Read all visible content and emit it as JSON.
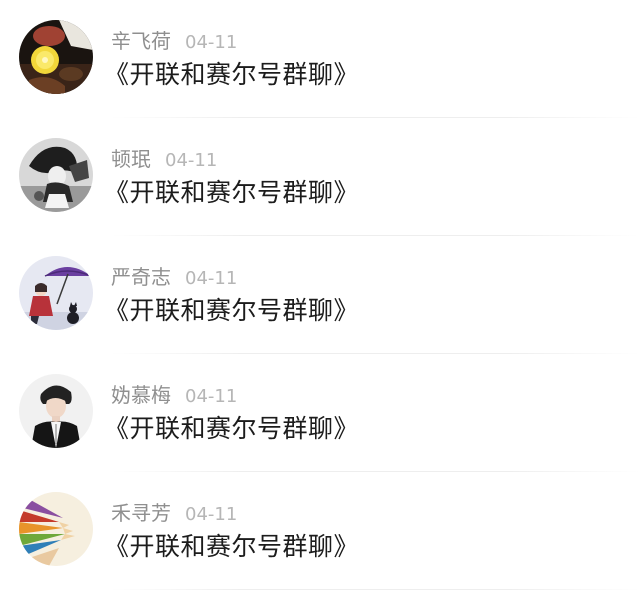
{
  "comments": [
    {
      "name": "辛飞荷",
      "time": "04-11",
      "message": "《开联和赛尔号群聊》",
      "avatar_icon": "avatar-lemon-drink-photo",
      "colors": {
        "bg": "#1a1410",
        "accent": "#f2d73a"
      }
    },
    {
      "name": "顿珉",
      "time": "04-11",
      "message": "《开联和赛尔号群聊》",
      "avatar_icon": "avatar-monochrome-girl-illustration",
      "colors": {
        "bg": "#d8d8d8",
        "accent": "#1e1e1e"
      }
    },
    {
      "name": "严奇志",
      "time": "04-11",
      "message": "《开联和赛尔号群聊》",
      "avatar_icon": "avatar-umbrella-girl-cat-illustration",
      "colors": {
        "bg": "#e6e8f2",
        "accent": "#6a3fa0"
      }
    },
    {
      "name": "妫慕梅",
      "time": "04-11",
      "message": "《开联和赛尔号群聊》",
      "avatar_icon": "avatar-boy-portrait-photo",
      "colors": {
        "bg": "#f1f1f1",
        "accent": "#222222"
      }
    },
    {
      "name": "禾寻芳",
      "time": "04-11",
      "message": "《开联和赛尔号群聊》",
      "avatar_icon": "avatar-colored-pencils-photo",
      "colors": {
        "bg": "#f6efdf",
        "accent": "#d9482b"
      }
    }
  ]
}
